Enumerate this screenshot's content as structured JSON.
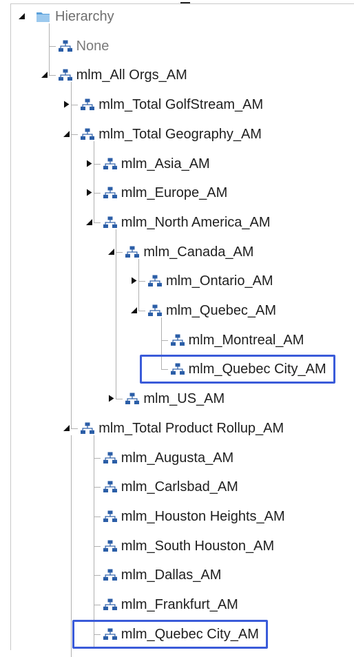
{
  "tree": {
    "nodes": [
      {
        "label": "Hierarchy",
        "depth": 0,
        "state": "expanded",
        "icon": "folder-icon",
        "style": "root"
      },
      {
        "label": "None",
        "depth": 1,
        "state": "leaf",
        "icon": "hierarchy-icon",
        "style": "dim"
      },
      {
        "label": "mlm_All Orgs_AM",
        "depth": 1,
        "state": "expanded",
        "icon": "hierarchy-icon"
      },
      {
        "label": "mlm_Total GolfStream_AM",
        "depth": 2,
        "state": "collapsed",
        "icon": "hierarchy-icon"
      },
      {
        "label": "mlm_Total Geography_AM",
        "depth": 2,
        "state": "expanded",
        "icon": "hierarchy-icon"
      },
      {
        "label": "mlm_Asia_AM",
        "depth": 3,
        "state": "collapsed",
        "icon": "hierarchy-icon"
      },
      {
        "label": "mlm_Europe_AM",
        "depth": 3,
        "state": "collapsed",
        "icon": "hierarchy-icon"
      },
      {
        "label": "mlm_North America_AM",
        "depth": 3,
        "state": "expanded",
        "icon": "hierarchy-icon"
      },
      {
        "label": "mlm_Canada_AM",
        "depth": 4,
        "state": "expanded",
        "icon": "hierarchy-icon"
      },
      {
        "label": "mlm_Ontario_AM",
        "depth": 5,
        "state": "collapsed",
        "icon": "hierarchy-icon"
      },
      {
        "label": "mlm_Quebec_AM",
        "depth": 5,
        "state": "expanded",
        "icon": "hierarchy-icon"
      },
      {
        "label": "mlm_Montreal_AM",
        "depth": 6,
        "state": "leaf",
        "icon": "hierarchy-icon"
      },
      {
        "label": "mlm_Quebec City_AM",
        "depth": 6,
        "state": "leaf",
        "icon": "hierarchy-icon",
        "highlighted": true
      },
      {
        "label": "mlm_US_AM",
        "depth": 4,
        "state": "collapsed",
        "icon": "hierarchy-icon"
      },
      {
        "label": "mlm_Total Product Rollup_AM",
        "depth": 2,
        "state": "expanded",
        "icon": "hierarchy-icon"
      },
      {
        "label": "mlm_Augusta_AM",
        "depth": 3,
        "state": "leaf",
        "icon": "hierarchy-icon"
      },
      {
        "label": "mlm_Carlsbad_AM",
        "depth": 3,
        "state": "leaf",
        "icon": "hierarchy-icon"
      },
      {
        "label": "mlm_Houston Heights_AM",
        "depth": 3,
        "state": "leaf",
        "icon": "hierarchy-icon"
      },
      {
        "label": "mlm_South Houston_AM",
        "depth": 3,
        "state": "leaf",
        "icon": "hierarchy-icon"
      },
      {
        "label": "mlm_Dallas_AM",
        "depth": 3,
        "state": "leaf",
        "icon": "hierarchy-icon"
      },
      {
        "label": "mlm_Frankfurt_AM",
        "depth": 3,
        "state": "leaf",
        "icon": "hierarchy-icon"
      },
      {
        "label": "mlm_Quebec City_AM",
        "depth": 3,
        "state": "leaf",
        "icon": "hierarchy-icon",
        "highlighted": true
      }
    ]
  },
  "colors": {
    "highlight_border": "#3a5bd9",
    "connector_line": "#b0b0b0",
    "hierarchy_icon": "#2b5ea7",
    "folder_icon": "#3a86c8"
  }
}
